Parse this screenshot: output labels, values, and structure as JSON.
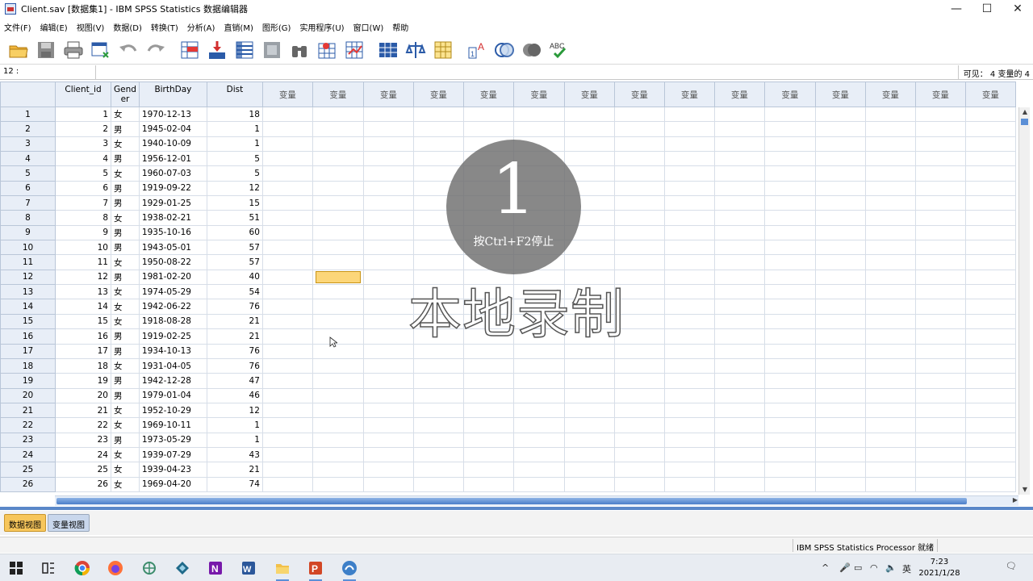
{
  "window": {
    "title": "Client.sav [数据集1] - IBM SPSS Statistics 数据编辑器",
    "minimize": "—",
    "maximize": "☐",
    "close": "✕"
  },
  "menu": [
    "文件(F)",
    "编辑(E)",
    "视图(V)",
    "数据(D)",
    "转换(T)",
    "分析(A)",
    "直销(M)",
    "图形(G)",
    "实用程序(U)",
    "窗口(W)",
    "帮助"
  ],
  "toolbar": {
    "icons": [
      "open-folder-icon",
      "save-icon",
      "print-icon",
      "recall-dialog-icon",
      "undo-icon",
      "redo-icon",
      "goto-case-icon",
      "goto-variable-icon",
      "variables-icon",
      "run-descriptives-icon",
      "find-icon",
      "insert-cases-icon",
      "insert-variable-icon",
      "split-file-icon",
      "weight-cases-icon",
      "select-cases-icon",
      "value-labels-icon",
      "use-variable-sets-icon",
      "show-all-variables-icon",
      "spell-check-icon"
    ]
  },
  "refbar": {
    "cell_ref": "12 :",
    "visible_info": "可见： 4 变量的 4"
  },
  "grid": {
    "columns": [
      "Client_id",
      "Gend er",
      "BirthDay",
      "Dist"
    ],
    "column_lines": [
      [
        "Client_id"
      ],
      [
        "Gend",
        "er"
      ],
      [
        "BirthDay"
      ],
      [
        "Dist"
      ]
    ],
    "empty_var_label": "变量",
    "empty_var_count": 15,
    "selected_row": 12,
    "selected_empty_col": 2,
    "rows": [
      {
        "n": "1",
        "id": "1",
        "g": "女",
        "b": "1970-12-13",
        "d": "18"
      },
      {
        "n": "2",
        "id": "2",
        "g": "男",
        "b": "1945-02-04",
        "d": "1"
      },
      {
        "n": "3",
        "id": "3",
        "g": "女",
        "b": "1940-10-09",
        "d": "1"
      },
      {
        "n": "4",
        "id": "4",
        "g": "男",
        "b": "1956-12-01",
        "d": "5"
      },
      {
        "n": "5",
        "id": "5",
        "g": "女",
        "b": "1960-07-03",
        "d": "5"
      },
      {
        "n": "6",
        "id": "6",
        "g": "男",
        "b": "1919-09-22",
        "d": "12"
      },
      {
        "n": "7",
        "id": "7",
        "g": "男",
        "b": "1929-01-25",
        "d": "15"
      },
      {
        "n": "8",
        "id": "8",
        "g": "女",
        "b": "1938-02-21",
        "d": "51"
      },
      {
        "n": "9",
        "id": "9",
        "g": "男",
        "b": "1935-10-16",
        "d": "60"
      },
      {
        "n": "10",
        "id": "10",
        "g": "男",
        "b": "1943-05-01",
        "d": "57"
      },
      {
        "n": "11",
        "id": "11",
        "g": "女",
        "b": "1950-08-22",
        "d": "57"
      },
      {
        "n": "12",
        "id": "12",
        "g": "男",
        "b": "1981-02-20",
        "d": "40"
      },
      {
        "n": "13",
        "id": "13",
        "g": "女",
        "b": "1974-05-29",
        "d": "54"
      },
      {
        "n": "14",
        "id": "14",
        "g": "女",
        "b": "1942-06-22",
        "d": "76"
      },
      {
        "n": "15",
        "id": "15",
        "g": "女",
        "b": "1918-08-28",
        "d": "21"
      },
      {
        "n": "16",
        "id": "16",
        "g": "男",
        "b": "1919-02-25",
        "d": "21"
      },
      {
        "n": "17",
        "id": "17",
        "g": "男",
        "b": "1934-10-13",
        "d": "76"
      },
      {
        "n": "18",
        "id": "18",
        "g": "女",
        "b": "1931-04-05",
        "d": "76"
      },
      {
        "n": "19",
        "id": "19",
        "g": "男",
        "b": "1942-12-28",
        "d": "47"
      },
      {
        "n": "20",
        "id": "20",
        "g": "男",
        "b": "1979-01-04",
        "d": "46"
      },
      {
        "n": "21",
        "id": "21",
        "g": "女",
        "b": "1952-10-29",
        "d": "12"
      },
      {
        "n": "22",
        "id": "22",
        "g": "女",
        "b": "1969-10-11",
        "d": "1"
      },
      {
        "n": "23",
        "id": "23",
        "g": "男",
        "b": "1973-05-29",
        "d": "1"
      },
      {
        "n": "24",
        "id": "24",
        "g": "女",
        "b": "1939-07-29",
        "d": "43"
      },
      {
        "n": "25",
        "id": "25",
        "g": "女",
        "b": "1939-04-23",
        "d": "21"
      },
      {
        "n": "26",
        "id": "26",
        "g": "女",
        "b": "1969-04-20",
        "d": "74"
      }
    ]
  },
  "tabs": {
    "data_view": "数据视图",
    "variable_view": "变量视图"
  },
  "status": "IBM SPSS Statistics Processor 就绪",
  "overlay": {
    "countdown": "1",
    "hint": "按Ctrl+F2停止",
    "label": "本地录制"
  },
  "taskbar": {
    "apps": [
      "windows-start-icon",
      "task-view-icon",
      "chrome-icon",
      "firefox-icon",
      "network-app-icon",
      "app-diamond-icon",
      "onenote-icon",
      "word-icon",
      "file-explorer-icon",
      "powerpoint-icon",
      "spss-icon"
    ],
    "tray_caret": "^",
    "tray_lang": "英",
    "time": "7:23",
    "date": "2021/1/28",
    "accent": "#5a8fd8"
  }
}
